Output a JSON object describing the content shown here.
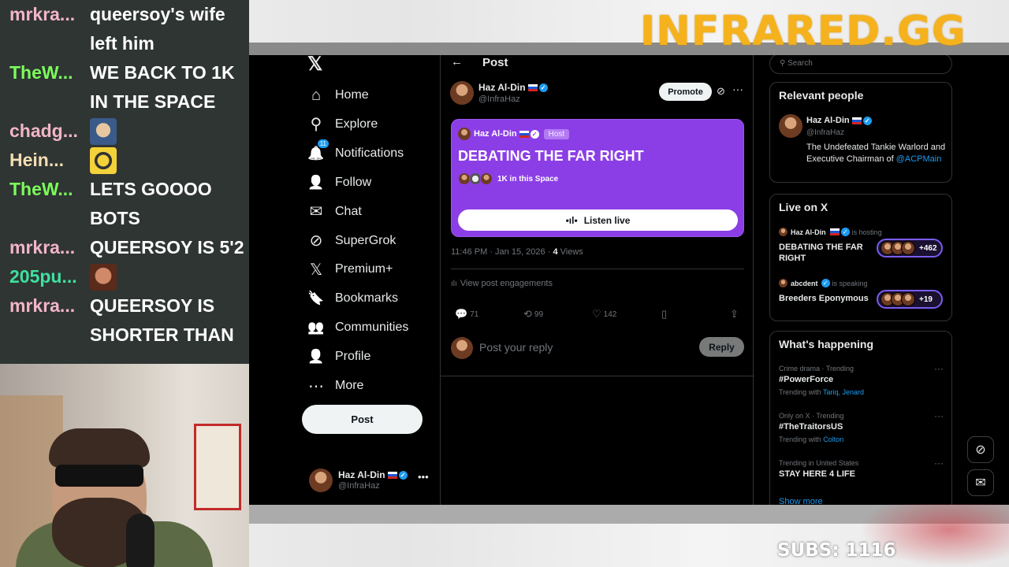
{
  "overlay": {
    "brand": "INFRARED.GG",
    "subs": "SUBS: 1116"
  },
  "chat": [
    {
      "user": "mrkra...",
      "color": "#f2b5c8",
      "lines": [
        "queersoy's wife",
        "left him"
      ]
    },
    {
      "user": "TheW...",
      "color": "#7cfc5a",
      "lines": [
        "WE BACK TO 1K",
        "IN THE SPACE"
      ]
    },
    {
      "user": "chadg...",
      "color": "#f2b5c8",
      "emote": "emote-face-icon"
    },
    {
      "user": "Hein...",
      "color": "#f5deb3",
      "emote": "emote-goggles-icon"
    },
    {
      "user": "TheW...",
      "color": "#7cfc5a",
      "lines": [
        "LETS GOOOO",
        "BOTS"
      ]
    },
    {
      "user": "mrkra...",
      "color": "#f2b5c8",
      "lines": [
        "QUEERSOY IS 5'2"
      ]
    },
    {
      "user": "205pu...",
      "color": "#3fe0a0",
      "emote": "emote-smirk-icon"
    },
    {
      "user": "mrkra...",
      "color": "#f2b5c8",
      "lines": [
        "QUEERSOY IS",
        "SHORTER THAN"
      ]
    }
  ],
  "nav": {
    "items": [
      {
        "label": "Home",
        "icon": "home-icon",
        "glyph": "⌂"
      },
      {
        "label": "Explore",
        "icon": "search-icon",
        "glyph": "⚲"
      },
      {
        "label": "Notifications",
        "icon": "bell-icon",
        "glyph": "🔔",
        "badge": "11"
      },
      {
        "label": "Follow",
        "icon": "follow-icon",
        "glyph": "👤"
      },
      {
        "label": "Chat",
        "icon": "mail-icon",
        "glyph": "✉"
      },
      {
        "label": "SuperGrok",
        "icon": "grok-icon",
        "glyph": "⊘"
      },
      {
        "label": "Premium+",
        "icon": "x-icon",
        "glyph": "𝕏"
      },
      {
        "label": "Bookmarks",
        "icon": "bookmark-icon",
        "glyph": "🔖"
      },
      {
        "label": "Communities",
        "icon": "communities-icon",
        "glyph": "👥"
      },
      {
        "label": "Profile",
        "icon": "profile-icon",
        "glyph": "👤"
      },
      {
        "label": "More",
        "icon": "more-circle-icon",
        "glyph": "⋯"
      }
    ],
    "post_label": "Post",
    "account": {
      "name": "Haz Al-Din",
      "handle": "@InfraHaz"
    }
  },
  "post": {
    "header_title": "Post",
    "author_name": "Haz Al-Din",
    "author_handle": "@InfraHaz",
    "promote_label": "Promote",
    "space": {
      "host_name": "Haz Al-Din",
      "host_badge": "Host",
      "title": "DEBATING THE FAR RIGHT",
      "audience": "1K in this Space",
      "listen_label": "Listen live"
    },
    "time": "11:46 PM · Jan 15, 2026 · ",
    "views_count": "4",
    "views_label": " Views",
    "engagements_label": "View post engagements",
    "replies": "71",
    "reposts": "99",
    "likes": "142",
    "reply_placeholder": "Post your reply",
    "reply_button": "Reply"
  },
  "sidebar": {
    "search_placeholder": "Search",
    "relevant": {
      "title": "Relevant people",
      "name": "Haz Al-Din",
      "handle": "@InfraHaz",
      "bio": "The Undefeated Tankie Warlord and Executive Chairman of ",
      "bio_link": "@ACPMain"
    },
    "live": {
      "title": "Live on X",
      "spaces": [
        {
          "host": "Haz Al-Din",
          "status": "is hosting",
          "title": "DEBATING THE FAR RIGHT",
          "count": "+462"
        },
        {
          "host": "abcdent",
          "status": "is speaking",
          "title": "Breeders Eponymous",
          "count": "+19"
        }
      ]
    },
    "happening": {
      "title": "What's happening",
      "trends": [
        {
          "context": "Crime drama · Trending",
          "tag": "#PowerForce",
          "with_label": "Trending with ",
          "with": "Tariq, Jenard"
        },
        {
          "context": "Only on X · Trending",
          "tag": "#TheTraitorsUS",
          "with_label": "Trending with ",
          "with": "Colton"
        },
        {
          "context": "Trending in United States",
          "tag": "STAY HERE 4 LIFE",
          "with_label": "",
          "with": ""
        }
      ],
      "show_more": "Show more"
    }
  },
  "colors": {
    "accent": "#1d9bf0",
    "space": "#8b3ee6",
    "brand": "#f5b21c"
  }
}
